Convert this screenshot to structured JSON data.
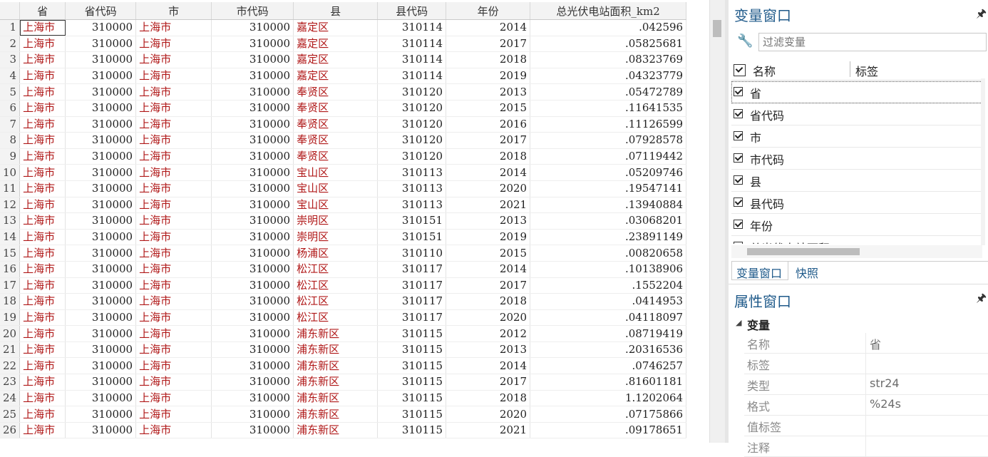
{
  "grid": {
    "columns": [
      "省",
      "省代码",
      "市",
      "市代码",
      "县",
      "县代码",
      "年份",
      "总光伏电站面积_km2"
    ],
    "rows": [
      [
        "1",
        "上海市",
        "310000",
        "上海市",
        "310000",
        "嘉定区",
        "310114",
        "2014",
        ".042596"
      ],
      [
        "2",
        "上海市",
        "310000",
        "上海市",
        "310000",
        "嘉定区",
        "310114",
        "2017",
        ".05825681"
      ],
      [
        "3",
        "上海市",
        "310000",
        "上海市",
        "310000",
        "嘉定区",
        "310114",
        "2018",
        ".08323769"
      ],
      [
        "4",
        "上海市",
        "310000",
        "上海市",
        "310000",
        "嘉定区",
        "310114",
        "2019",
        ".04323779"
      ],
      [
        "5",
        "上海市",
        "310000",
        "上海市",
        "310000",
        "奉贤区",
        "310120",
        "2013",
        ".05472789"
      ],
      [
        "6",
        "上海市",
        "310000",
        "上海市",
        "310000",
        "奉贤区",
        "310120",
        "2015",
        ".11641535"
      ],
      [
        "7",
        "上海市",
        "310000",
        "上海市",
        "310000",
        "奉贤区",
        "310120",
        "2016",
        ".11126599"
      ],
      [
        "8",
        "上海市",
        "310000",
        "上海市",
        "310000",
        "奉贤区",
        "310120",
        "2017",
        ".07928578"
      ],
      [
        "9",
        "上海市",
        "310000",
        "上海市",
        "310000",
        "奉贤区",
        "310120",
        "2018",
        ".07119442"
      ],
      [
        "10",
        "上海市",
        "310000",
        "上海市",
        "310000",
        "宝山区",
        "310113",
        "2014",
        ".05209746"
      ],
      [
        "11",
        "上海市",
        "310000",
        "上海市",
        "310000",
        "宝山区",
        "310113",
        "2020",
        ".19547141"
      ],
      [
        "12",
        "上海市",
        "310000",
        "上海市",
        "310000",
        "宝山区",
        "310113",
        "2021",
        ".13940884"
      ],
      [
        "13",
        "上海市",
        "310000",
        "上海市",
        "310000",
        "崇明区",
        "310151",
        "2013",
        ".03068201"
      ],
      [
        "14",
        "上海市",
        "310000",
        "上海市",
        "310000",
        "崇明区",
        "310151",
        "2019",
        ".23891149"
      ],
      [
        "15",
        "上海市",
        "310000",
        "上海市",
        "310000",
        "杨浦区",
        "310110",
        "2015",
        ".00820658"
      ],
      [
        "16",
        "上海市",
        "310000",
        "上海市",
        "310000",
        "松江区",
        "310117",
        "2014",
        ".10138906"
      ],
      [
        "17",
        "上海市",
        "310000",
        "上海市",
        "310000",
        "松江区",
        "310117",
        "2017",
        ".1552204"
      ],
      [
        "18",
        "上海市",
        "310000",
        "上海市",
        "310000",
        "松江区",
        "310117",
        "2018",
        ".0414953"
      ],
      [
        "19",
        "上海市",
        "310000",
        "上海市",
        "310000",
        "松江区",
        "310117",
        "2020",
        ".04118097"
      ],
      [
        "20",
        "上海市",
        "310000",
        "上海市",
        "310000",
        "浦东新区",
        "310115",
        "2012",
        ".08719419"
      ],
      [
        "21",
        "上海市",
        "310000",
        "上海市",
        "310000",
        "浦东新区",
        "310115",
        "2013",
        ".20316536"
      ],
      [
        "22",
        "上海市",
        "310000",
        "上海市",
        "310000",
        "浦东新区",
        "310115",
        "2014",
        ".0746257"
      ],
      [
        "23",
        "上海市",
        "310000",
        "上海市",
        "310000",
        "浦东新区",
        "310115",
        "2017",
        ".81601181"
      ],
      [
        "24",
        "上海市",
        "310000",
        "上海市",
        "310000",
        "浦东新区",
        "310115",
        "2018",
        "1.1202064"
      ],
      [
        "25",
        "上海市",
        "310000",
        "上海市",
        "310000",
        "浦东新区",
        "310115",
        "2020",
        ".07175866"
      ],
      [
        "26",
        "上海市",
        "310000",
        "上海市",
        "310000",
        "浦东新区",
        "310115",
        "2021",
        ".09178651"
      ]
    ],
    "string_color": "#b01818"
  },
  "variables_window": {
    "title": "变量窗口",
    "filter_placeholder": "过滤变量",
    "header_name": "名称",
    "header_label": "标签",
    "items": [
      "省",
      "省代码",
      "市",
      "市代码",
      "县",
      "县代码",
      "年份",
      "总光伏电站面积..."
    ],
    "tabs": [
      "变量窗口",
      "快照"
    ]
  },
  "properties_window": {
    "title": "属性窗口",
    "group": "变量",
    "rows": [
      {
        "key": "名称",
        "value": "省"
      },
      {
        "key": "标签",
        "value": ""
      },
      {
        "key": "类型",
        "value": "str24"
      },
      {
        "key": "格式",
        "value": "%24s"
      },
      {
        "key": "值标签",
        "value": ""
      },
      {
        "key": "注释",
        "value": ""
      }
    ]
  },
  "icons": {
    "pin": "pin-icon",
    "wrench": "wrench-icon",
    "collapse": "collapse-triangle-icon"
  }
}
